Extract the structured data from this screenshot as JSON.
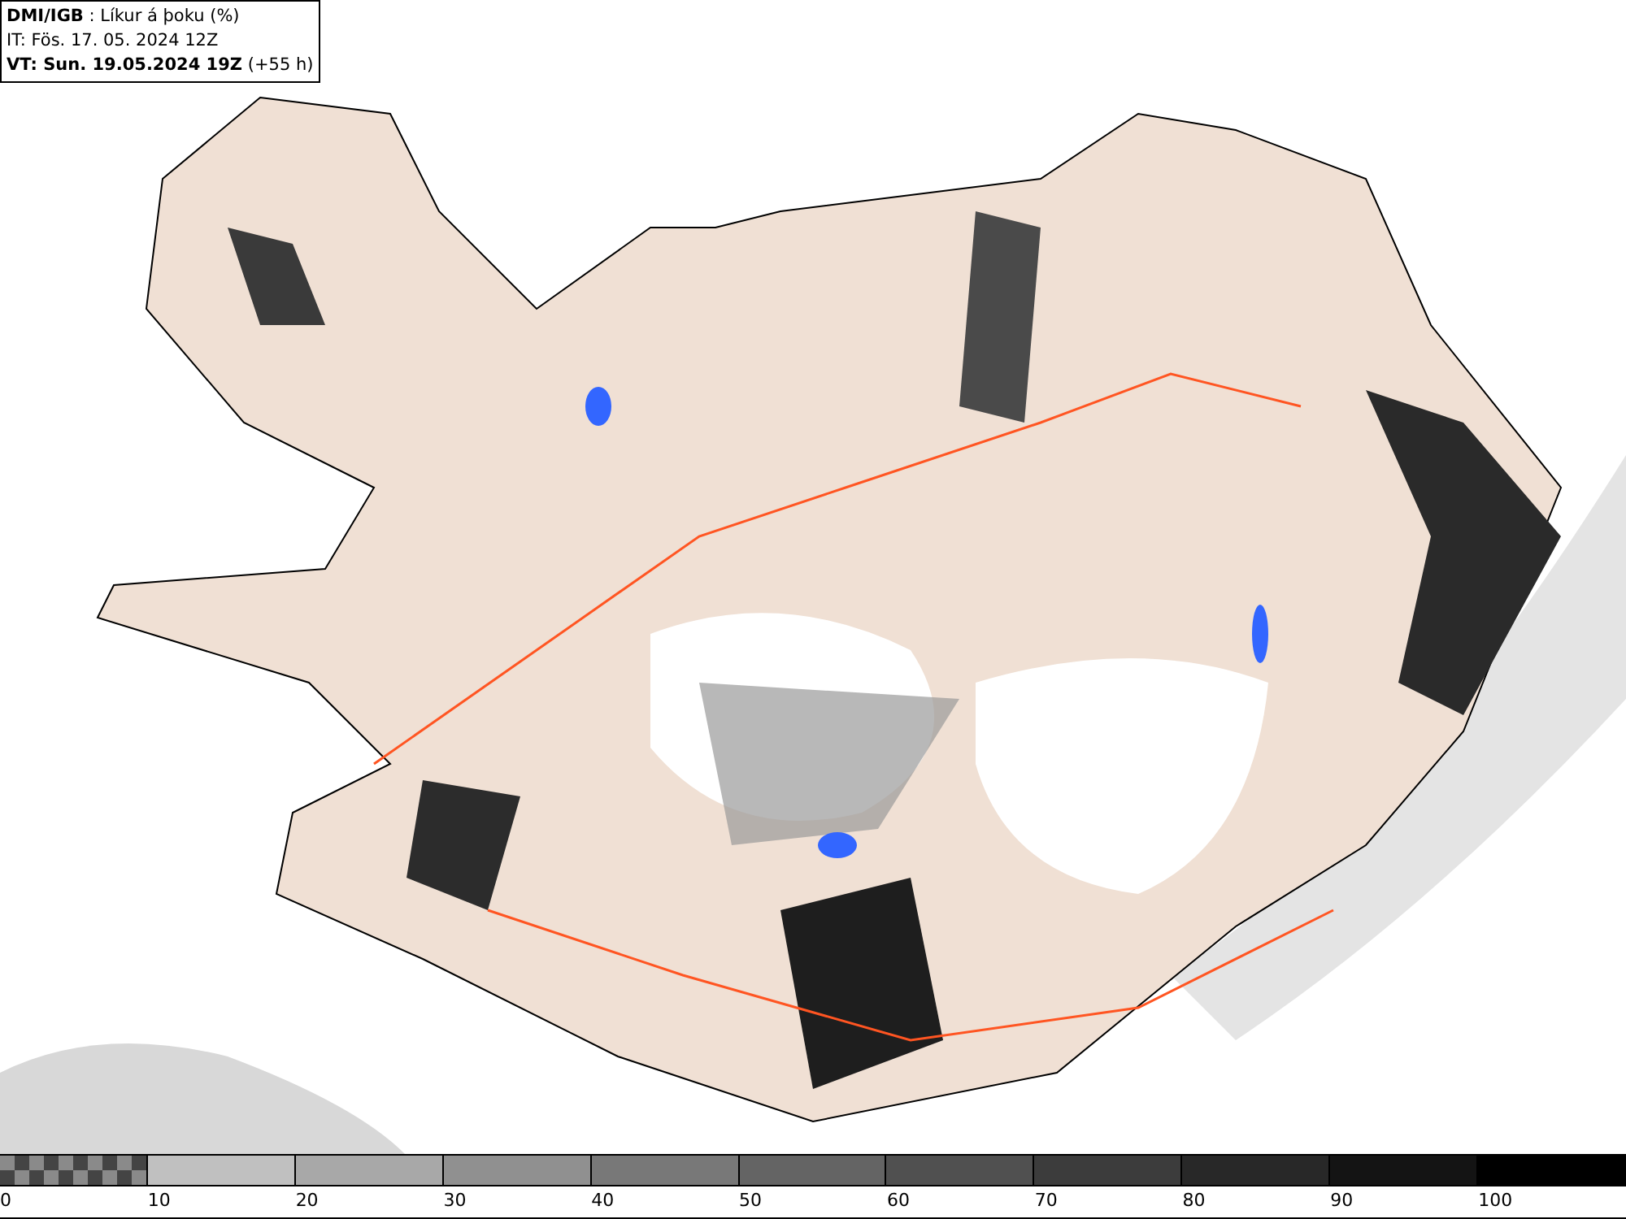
{
  "header": {
    "source": "DMI/IGB",
    "title": " : Líkur á þoku (%)",
    "issue_time": "IT: Fös. 17. 05. 2024 12Z",
    "valid_time": "VT: Sun. 19.05.2024 19Z",
    "lead": "(+55 h)"
  },
  "legend": [
    {
      "label": "0",
      "kind": "checker"
    },
    {
      "label": "10",
      "kind": "solid",
      "color": "#c0c0c0"
    },
    {
      "label": "20",
      "kind": "solid",
      "color": "#a8a8a8"
    },
    {
      "label": "30",
      "kind": "solid",
      "color": "#909090"
    },
    {
      "label": "40",
      "kind": "solid",
      "color": "#787878"
    },
    {
      "label": "50",
      "kind": "solid",
      "color": "#646464"
    },
    {
      "label": "60",
      "kind": "solid",
      "color": "#505050"
    },
    {
      "label": "70",
      "kind": "solid",
      "color": "#3c3c3c"
    },
    {
      "label": "80",
      "kind": "solid",
      "color": "#282828"
    },
    {
      "label": "90",
      "kind": "solid",
      "color": "#141414"
    },
    {
      "label": "100",
      "kind": "solid",
      "color": "#000000"
    }
  ]
}
